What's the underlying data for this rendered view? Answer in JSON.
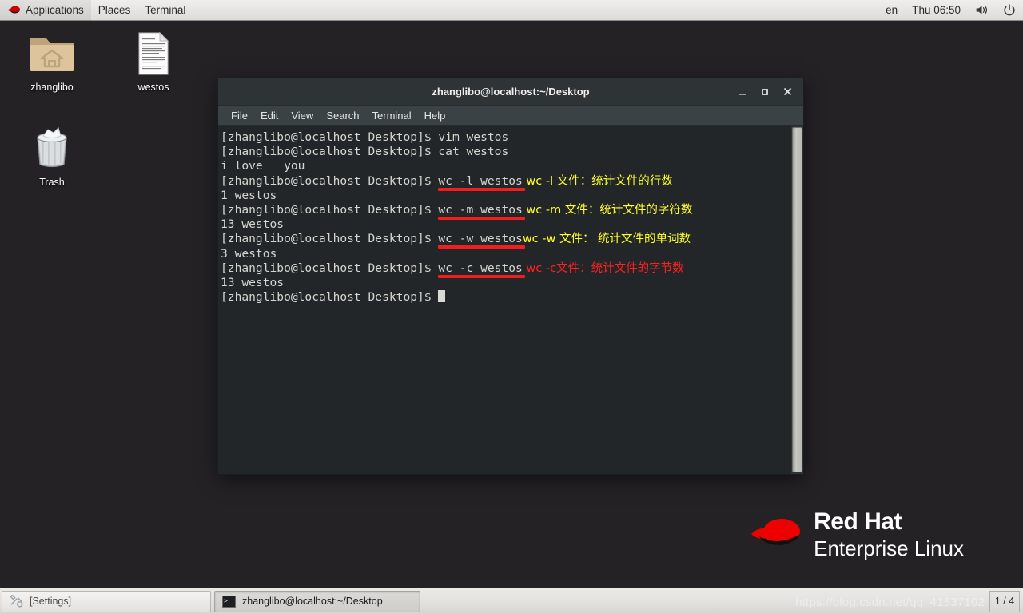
{
  "top_panel": {
    "logo_icon": "redhat-logo-icon",
    "items": [
      {
        "label": "Applications",
        "name": "applications-menu"
      },
      {
        "label": "Places",
        "name": "places-menu"
      },
      {
        "label": "Terminal",
        "name": "terminal-menu"
      }
    ],
    "keyboard_layout": "en",
    "clock": "Thu 06:50",
    "volume_icon": "volume-icon",
    "power_icon": "power-icon"
  },
  "desktop": {
    "icons": [
      {
        "label": "zhanglibo",
        "icon": "home-folder-icon"
      },
      {
        "label": "westos",
        "icon": "text-document-icon"
      },
      {
        "label": "Trash",
        "icon": "trash-icon"
      }
    ],
    "brand": {
      "line1": "Red Hat",
      "line2": "Enterprise Linux",
      "logo_icon": "redhat-hat-icon",
      "accent": "#ee0000"
    }
  },
  "terminal": {
    "title": "zhanglibo@localhost:~/Desktop",
    "window_buttons": {
      "minimize": "_",
      "maximize": "□",
      "close": "×"
    },
    "menus": [
      "File",
      "Edit",
      "View",
      "Search",
      "Terminal",
      "Help"
    ],
    "colors": {
      "background": "#232629",
      "foreground": "#d3d7cf",
      "annotation_yellow": "#ffff2b",
      "annotation_red": "#ff2020",
      "underline_red": "#f21d1d"
    },
    "prompt": "[zhanglibo@localhost Desktop]$ ",
    "lines": [
      {
        "prompt": "[zhanglibo@localhost Desktop]$ ",
        "command": "vim westos",
        "annotation": "",
        "annotation_color": "",
        "underline": false
      },
      {
        "prompt": "[zhanglibo@localhost Desktop]$ ",
        "command": "cat westos",
        "annotation": "",
        "annotation_color": "",
        "underline": false
      },
      {
        "prompt": "",
        "command": "i love   you",
        "annotation": "",
        "annotation_color": "",
        "underline": false
      },
      {
        "prompt": "[zhanglibo@localhost Desktop]$ ",
        "command": "wc -l westos",
        "annotation": " wc -l 文件：统计文件的行数",
        "annotation_color": "yellow",
        "underline": true
      },
      {
        "prompt": "",
        "command": "1 westos",
        "annotation": "",
        "annotation_color": "",
        "underline": false
      },
      {
        "prompt": "[zhanglibo@localhost Desktop]$ ",
        "command": "wc -m westos",
        "annotation": " wc -m 文件：统计文件的字符数",
        "annotation_color": "yellow",
        "underline": true
      },
      {
        "prompt": "",
        "command": "13 westos",
        "annotation": "",
        "annotation_color": "",
        "underline": false
      },
      {
        "prompt": "[zhanglibo@localhost Desktop]$ ",
        "command": "wc -w westos",
        "annotation": "wc -w 文件： 统计文件的单词数",
        "annotation_color": "yellow",
        "underline": true
      },
      {
        "prompt": "",
        "command": "3 westos",
        "annotation": "",
        "annotation_color": "",
        "underline": false
      },
      {
        "prompt": "[zhanglibo@localhost Desktop]$ ",
        "command": "wc -c westos",
        "annotation": " wc -c文件：统计文件的字节数",
        "annotation_color": "red",
        "underline": true
      },
      {
        "prompt": "",
        "command": "13 westos",
        "annotation": "",
        "annotation_color": "",
        "underline": false
      },
      {
        "prompt": "[zhanglibo@localhost Desktop]$ ",
        "command": "",
        "annotation": "",
        "annotation_color": "",
        "underline": false,
        "cursor": true
      }
    ]
  },
  "bottom_panel": {
    "tasks": [
      {
        "label": "[Settings]",
        "icon": "tools-icon",
        "active": false
      },
      {
        "label": "zhanglibo@localhost:~/Desktop",
        "icon": "terminal-icon",
        "active": true
      }
    ],
    "workspace": "1 / 4"
  },
  "watermark": "https://blog.csdn.net/qq_41537102"
}
